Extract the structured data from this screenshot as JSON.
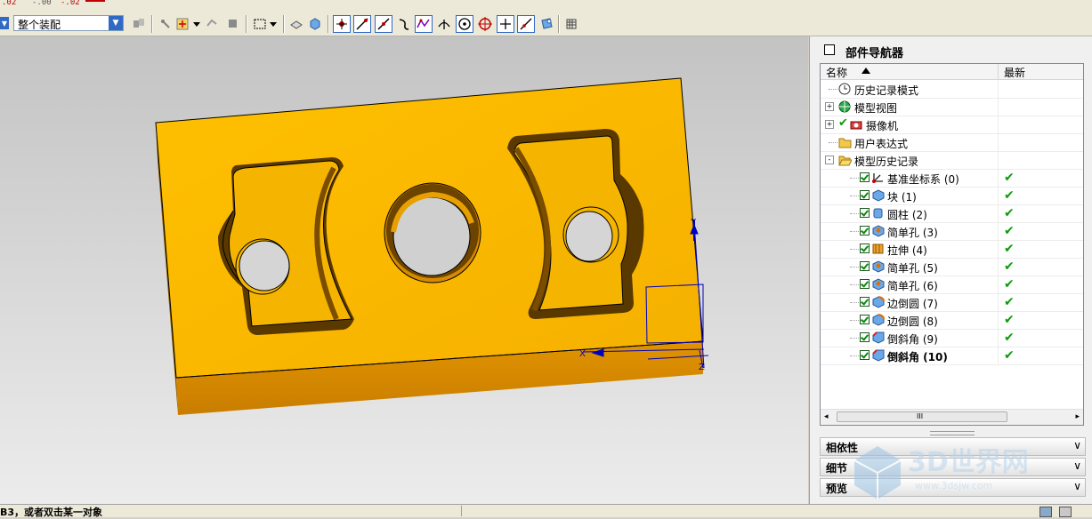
{
  "top_strip": {
    "values": [
      ".02",
      "-.00",
      "-.02"
    ]
  },
  "toolbar": {
    "filter_value": "整个装配",
    "icons": [
      "collapse-arrow",
      "filter-dropdown",
      "assembly-icon",
      "snap-point-icon",
      "select-box-icon",
      "part-icon",
      "block-icon",
      "endpoint-icon",
      "line-icon",
      "midpoint-icon",
      "curve-icon",
      "intersect-icon",
      "perpendicular-icon",
      "center-icon",
      "quadrant-icon",
      "point-icon",
      "tangent-icon",
      "existing-point-icon",
      "grid-icon"
    ]
  },
  "navigator": {
    "title": "部件导航器",
    "columns": {
      "name": "名称",
      "latest": "最新"
    },
    "rows": [
      {
        "label": "历史记录模式",
        "indent": 0,
        "icon": "clock-icon",
        "expander": "",
        "checked": false,
        "latest": ""
      },
      {
        "label": "模型视图",
        "indent": 0,
        "icon": "model-view-icon",
        "expander": "+",
        "checked": false,
        "latest": ""
      },
      {
        "label": "摄像机",
        "indent": 0,
        "icon": "camera-icon",
        "expander": "+",
        "checked": true,
        "latest": ""
      },
      {
        "label": "用户表达式",
        "indent": 0,
        "icon": "folder-icon",
        "expander": "",
        "checked": false,
        "latest": ""
      },
      {
        "label": "模型历史记录",
        "indent": 0,
        "icon": "folder-open-icon",
        "expander": "-",
        "checked": false,
        "latest": ""
      },
      {
        "label": "基准坐标系 (0)",
        "indent": 1,
        "icon": "datum-csys-icon",
        "expander": "",
        "checked": true,
        "latest": "✔"
      },
      {
        "label": "块 (1)",
        "indent": 1,
        "icon": "block-feature-icon",
        "expander": "",
        "checked": true,
        "latest": "✔"
      },
      {
        "label": "圆柱 (2)",
        "indent": 1,
        "icon": "cylinder-icon",
        "expander": "",
        "checked": true,
        "latest": "✔"
      },
      {
        "label": "简单孔 (3)",
        "indent": 1,
        "icon": "hole-icon",
        "expander": "",
        "checked": true,
        "latest": "✔"
      },
      {
        "label": "拉伸 (4)",
        "indent": 1,
        "icon": "extrude-icon",
        "expander": "",
        "checked": true,
        "latest": "✔"
      },
      {
        "label": "简单孔 (5)",
        "indent": 1,
        "icon": "hole-icon",
        "expander": "",
        "checked": true,
        "latest": "✔"
      },
      {
        "label": "简单孔 (6)",
        "indent": 1,
        "icon": "hole-icon",
        "expander": "",
        "checked": true,
        "latest": "✔"
      },
      {
        "label": "边倒圆 (7)",
        "indent": 1,
        "icon": "edge-blend-icon",
        "expander": "",
        "checked": true,
        "latest": "✔"
      },
      {
        "label": "边倒圆 (8)",
        "indent": 1,
        "icon": "edge-blend-icon",
        "expander": "",
        "checked": true,
        "latest": "✔"
      },
      {
        "label": "倒斜角 (9)",
        "indent": 1,
        "icon": "chamfer-icon",
        "expander": "",
        "checked": true,
        "latest": "✔"
      },
      {
        "label": "倒斜角 (10)",
        "indent": 1,
        "icon": "chamfer-icon",
        "expander": "",
        "checked": true,
        "latest": "✔",
        "bold": true
      }
    ],
    "sections": [
      "相依性",
      "细节",
      "预览"
    ],
    "scroll_mid": "III"
  },
  "viewport": {
    "axes": {
      "x": "X",
      "y": "Y",
      "z": "Z"
    }
  },
  "status": {
    "message": "B3，或者双击某一对象"
  },
  "watermark": {
    "text": "3D世界网",
    "url": "www.3dsjw.com"
  },
  "colors": {
    "part_top": "#f9b800",
    "part_side": "#dc8c00",
    "part_dark": "#7a4d00",
    "check": "#0b9b0b",
    "axis": "#0000c0"
  }
}
